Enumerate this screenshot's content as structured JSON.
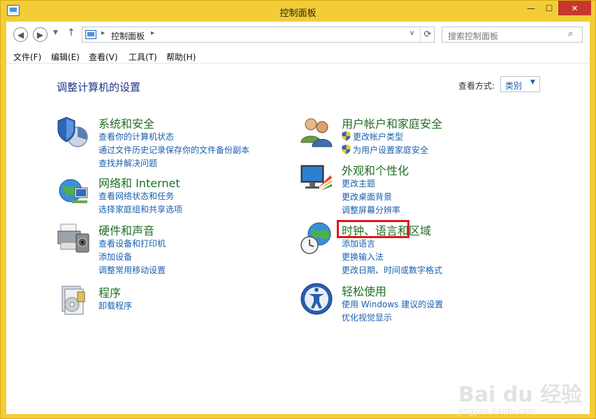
{
  "window": {
    "title": "控制面板",
    "buttons": {
      "minimize": "—",
      "maximize": "☐",
      "close": "✕"
    }
  },
  "nav": {
    "back_icon": "◀",
    "forward_icon": "▶",
    "recent_icon": "▼",
    "up_icon": "↑",
    "address": {
      "separator1": "▸",
      "location": "控制面板",
      "separator2": "▸",
      "dropdown": "∨",
      "refresh": "⟳"
    },
    "search": {
      "placeholder": "搜索控制面板",
      "icon": "⌕"
    }
  },
  "menu": [
    {
      "label": "文件(F)"
    },
    {
      "label": "编辑(E)"
    },
    {
      "label": "查看(V)"
    },
    {
      "label": "工具(T)"
    },
    {
      "label": "帮助(H)"
    }
  ],
  "main": {
    "heading": "调整计算机的设置",
    "view_by_label": "查看方式:",
    "view_by_value": "类别",
    "view_by_arrow": "▼"
  },
  "categories": {
    "system": {
      "title": "系统和安全",
      "links": [
        "查看你的计算机状态",
        "通过文件历史记录保存你的文件备份副本",
        "查找并解决问题"
      ]
    },
    "network": {
      "title": "网络和 Internet",
      "links": [
        "查看网络状态和任务",
        "选择家庭组和共享选项"
      ]
    },
    "hardware": {
      "title": "硬件和声音",
      "links": [
        "查看设备和打印机",
        "添加设备",
        "调整常用移动设置"
      ]
    },
    "programs": {
      "title": "程序",
      "links": [
        "卸载程序"
      ]
    },
    "users": {
      "title": "用户帐户和家庭安全",
      "links": [
        "更改帐户类型",
        "为用户设置家庭安全"
      ]
    },
    "appearance": {
      "title": "外观和个性化",
      "links": [
        "更改主题",
        "更改桌面背景",
        "调整屏幕分辨率"
      ]
    },
    "clock": {
      "title": "时钟、语言和区域",
      "links": [
        "添加语言",
        "更换输入法",
        "更改日期、时间或数字格式"
      ]
    },
    "ease": {
      "title": "轻松使用",
      "links": [
        "使用 Windows 建议的设置",
        "优化视觉显示"
      ]
    }
  },
  "watermark": {
    "brand": "Bai du 经验",
    "url": "jingyan.baidu.com"
  },
  "colors": {
    "title_bar": "#f3cd38",
    "link": "#1a5fae",
    "category_title": "#1f6e24",
    "heading": "#1e3287",
    "highlight": "#e0141e",
    "close_button": "#c7372c"
  }
}
